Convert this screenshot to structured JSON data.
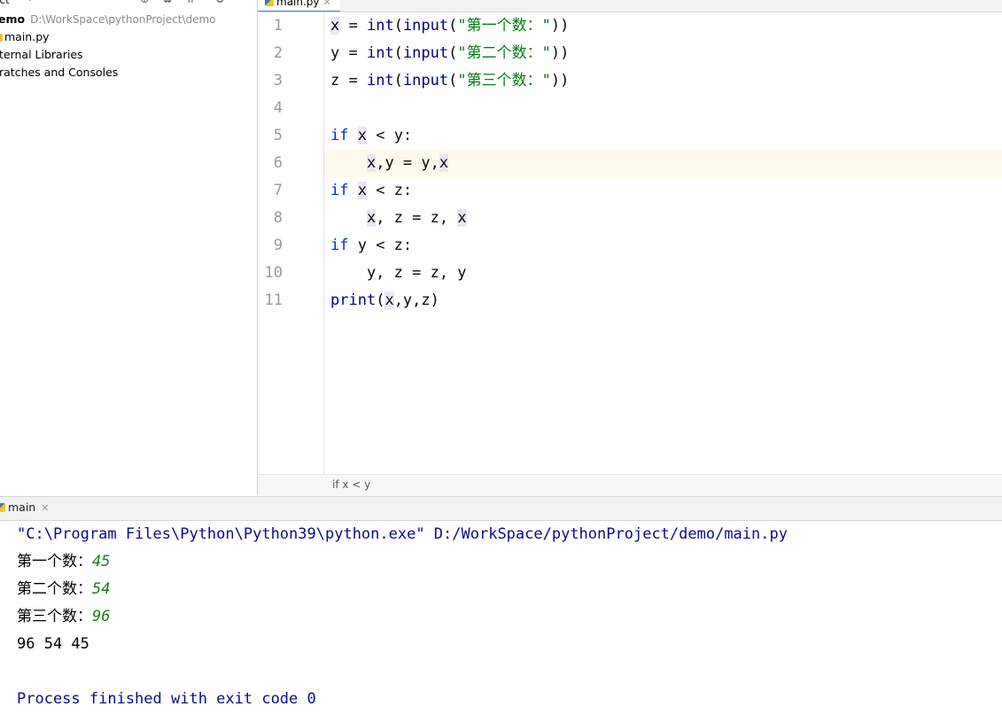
{
  "project": {
    "panel_title": "ect",
    "root_name": "emo",
    "root_path": "D:\\WorkSpace\\pythonProject\\demo",
    "items": [
      {
        "label": "main.py"
      },
      {
        "label": "ternal Libraries"
      },
      {
        "label": "ratches and Consoles"
      }
    ]
  },
  "editor": {
    "tab_label": "main.py",
    "current_line": 6,
    "line_numbers": [
      "1",
      "2",
      "3",
      "4",
      "5",
      "6",
      "7",
      "8",
      "9",
      "10",
      "11"
    ],
    "lines": [
      "x = int(input(\"第一个数：\"))",
      "y = int(input(\"第二个数：\"))",
      "z = int(input(\"第三个数：\"))",
      "",
      "if x < y:",
      "    x,y = y,x",
      "if x < z:",
      "    x, z = z, x",
      "if y < z:",
      "    y, z = z, y",
      "print(x,y,z)"
    ],
    "breadcrumb": "if x < y"
  },
  "run": {
    "tab_label": "main",
    "command": "\"C:\\Program Files\\Python\\Python39\\python.exe\" D:/WorkSpace/pythonProject/demo/main.py",
    "prompts": [
      {
        "label": "第一个数：",
        "input": "45"
      },
      {
        "label": "第二个数：",
        "input": "54"
      },
      {
        "label": "第三个数：",
        "input": "96"
      }
    ],
    "result": "96 54 45",
    "exit_message": "Process finished with exit code 0"
  },
  "colors": {
    "keyword": "#0033b3",
    "builtin": "#000080",
    "string": "#067d17",
    "console_input": "#1b7d1b",
    "console_system": "#0b0b8a",
    "current_line": "#fcfaed"
  }
}
